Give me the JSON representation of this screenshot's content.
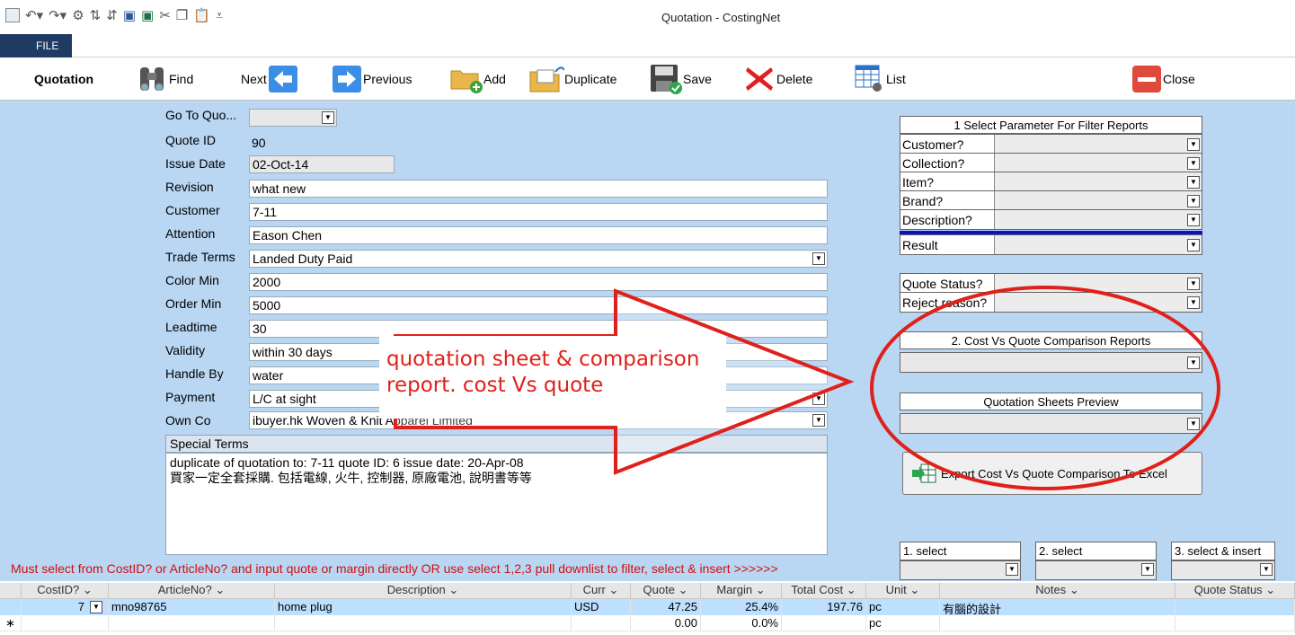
{
  "window": {
    "title": "Quotation - CostingNet",
    "file_tab": "FILE"
  },
  "toolbar": {
    "form_title": "Quotation",
    "find": "Find",
    "next": "Next",
    "previous": "Previous",
    "add": "Add",
    "duplicate": "Duplicate",
    "save": "Save",
    "delete": "Delete",
    "list": "List",
    "close": "Close"
  },
  "form": {
    "goto_label": "Go To Quo...",
    "goto_value": "",
    "quote_id_label": "Quote ID",
    "quote_id": "90",
    "issue_date_label": "Issue Date",
    "issue_date": "02-Oct-14",
    "revision_label": "Revision",
    "revision": "what new",
    "customer_label": "Customer",
    "customer": "7-11",
    "attention_label": "Attention",
    "attention": "Eason Chen",
    "trade_terms_label": "Trade Terms",
    "trade_terms": "Landed Duty Paid",
    "color_min_label": "Color Min",
    "color_min": "2000",
    "order_min_label": "Order Min",
    "order_min": "5000",
    "leadtime_label": "Leadtime",
    "leadtime": "30",
    "validity_label": "Validity",
    "validity": "within 30 days",
    "handle_by_label": "Handle By",
    "handle_by": "water",
    "payment_label": "Payment",
    "payment": "L/C at sight",
    "own_co_label": "Own Co",
    "own_co": "ibuyer.hk Woven & Knit Apparel Limited",
    "special_terms_label": "Special Terms",
    "special_terms_line1": "duplicate of quotation to: 7-11 quote ID: 6  issue date: 20-Apr-08",
    "special_terms_line2": "買家一定全套採購. 包括電線, 火牛, 控制器, 原廠電池, 說明書等等"
  },
  "annotation": {
    "line1": "quotation sheet & comparison",
    "line2": "report. cost Vs quote"
  },
  "filter_panel": {
    "header": "1 Select Parameter For Filter Reports",
    "customer": "Customer?",
    "collection": "Collection?",
    "item": "Item?",
    "brand": "Brand?",
    "description": "Description?",
    "result": "Result",
    "quote_status": "Quote Status?",
    "reject_reason": "Reject reason?",
    "comparison_header": "2. Cost Vs Quote Comparison Reports",
    "preview_header": "Quotation Sheets Preview",
    "export_button": "Export Cost Vs Quote Comparison To Excel",
    "select1": "1. select",
    "select2": "2. select",
    "select3": "3. select & insert"
  },
  "instruction": "Must select from CostID? or ArticleNo? and input quote or margin directly OR use select 1,2,3 pull downlist to filter, select & insert >>>>>>",
  "grid": {
    "columns": [
      "CostID?",
      "ArticleNo?",
      "Description",
      "Curr",
      "Quote",
      "Margin",
      "Total Cost",
      "Unit",
      "Notes",
      "Quote Status"
    ],
    "rows": [
      {
        "cost_id": "7",
        "article_no": "mno98765",
        "description": "home plug",
        "curr": "USD",
        "quote": "47.25",
        "margin": "25.4%",
        "total_cost": "197.76",
        "unit": "pc",
        "notes": "有腦的設計",
        "quote_status": ""
      }
    ],
    "new_row": {
      "marker": "∗",
      "quote": "0.00",
      "margin": "0.0%",
      "unit": "pc"
    }
  },
  "colors": {
    "form_background": "#b9d6f2",
    "annotation_red": "#e0201a",
    "instruction_red": "#d01010",
    "selected_row": "#bde0ff"
  }
}
